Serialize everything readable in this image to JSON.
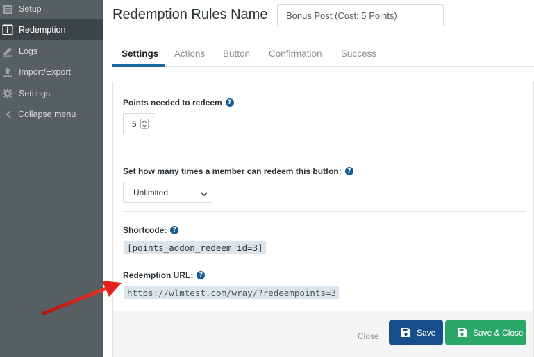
{
  "sidebar": {
    "items": [
      {
        "label": "Setup",
        "icon": "grid-icon"
      },
      {
        "label": "Redemption",
        "icon": "info-icon",
        "active": true
      },
      {
        "label": "Logs",
        "icon": "pencil-icon"
      },
      {
        "label": "Import/Export",
        "icon": "upload-icon"
      },
      {
        "label": "Settings",
        "icon": "gear-icon"
      },
      {
        "label": "Collapse menu",
        "icon": "chevron-left-icon"
      }
    ]
  },
  "header": {
    "title": "Redemption Rules Name",
    "name_value": "Bonus Post (Cost: 5 Points)"
  },
  "tabs": [
    {
      "label": "Settings",
      "active": true
    },
    {
      "label": "Actions"
    },
    {
      "label": "Button"
    },
    {
      "label": "Confirmation"
    },
    {
      "label": "Success"
    }
  ],
  "form": {
    "points_label": "Points needed to redeem",
    "points_value": "5",
    "times_label": "Set how many times a member can redeem this button:",
    "times_value": "Unlimited",
    "shortcode_label": "Shortcode:",
    "shortcode_value": "[points_addon_redeem id=3]",
    "url_label": "Redemption URL:",
    "url_value": "https://wlmtest.com/wray/?redeempoints=3",
    "help_glyph": "?"
  },
  "footer": {
    "close_label": "Close",
    "save_label": "Save",
    "save_close_label": "Save & Close"
  },
  "colors": {
    "accent": "#1a6aa5",
    "save": "#154d8d",
    "save_close": "#2ba867",
    "arrow": "#e3231c"
  }
}
